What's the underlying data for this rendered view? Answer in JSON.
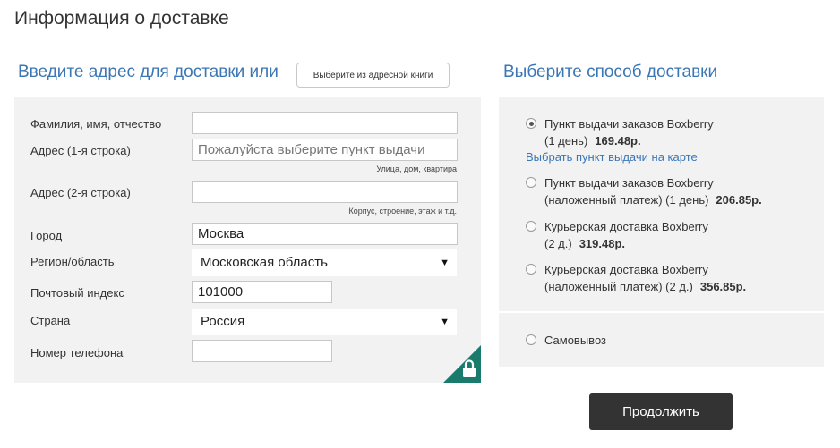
{
  "page_title": "Информация о доставке",
  "address_section": {
    "title": "Введите адрес для доставки или",
    "address_book_button": "Выберите из адресной книги",
    "fields": {
      "full_name": {
        "label": "Фамилия, имя, отчество",
        "value": ""
      },
      "address1": {
        "label": "Адрес (1-я строка)",
        "placeholder": "Пожалуйста выберите пункт выдачи",
        "hint": "Улица, дом, квартира"
      },
      "address2": {
        "label": "Адрес (2-я строка)",
        "value": "",
        "hint": "Корпус, строение, этаж и т.д."
      },
      "city": {
        "label": "Город",
        "value": "Москва"
      },
      "region": {
        "label": "Регион/область",
        "value": "Московская область"
      },
      "zip": {
        "label": "Почтовый индекс",
        "value": "101000"
      },
      "country": {
        "label": "Страна",
        "value": "Россия"
      },
      "phone": {
        "label": "Номер телефона",
        "value": ""
      }
    },
    "secure_icon": "lock-icon"
  },
  "shipping_section": {
    "title": "Выберите способ доставки",
    "options": [
      {
        "line1": "Пункт выдачи заказов Boxberry",
        "line2": "(1 день)",
        "price": "169.48р.",
        "selected": true
      },
      {
        "line1": "Пункт выдачи заказов Boxberry",
        "line2": "(наложенный платеж) (1 день)",
        "price": "206.85р.",
        "selected": false
      },
      {
        "line1": "Курьерская доставка Boxberry",
        "line2": "(2 д.)",
        "price": "319.48р.",
        "selected": false
      },
      {
        "line1": "Курьерская доставка Boxberry",
        "line2": "(наложенный платеж) (2 д.)",
        "price": "356.85р.",
        "selected": false
      }
    ],
    "map_link": "Выбрать пункт выдачи на карте",
    "pickup": {
      "label": "Самовывоз",
      "selected": false
    }
  },
  "continue_button": "Продолжить",
  "colors": {
    "accent": "#3b76b5",
    "panel": "#f2f2f2",
    "button": "#333333",
    "lock_corner": "#1a7a6b"
  }
}
